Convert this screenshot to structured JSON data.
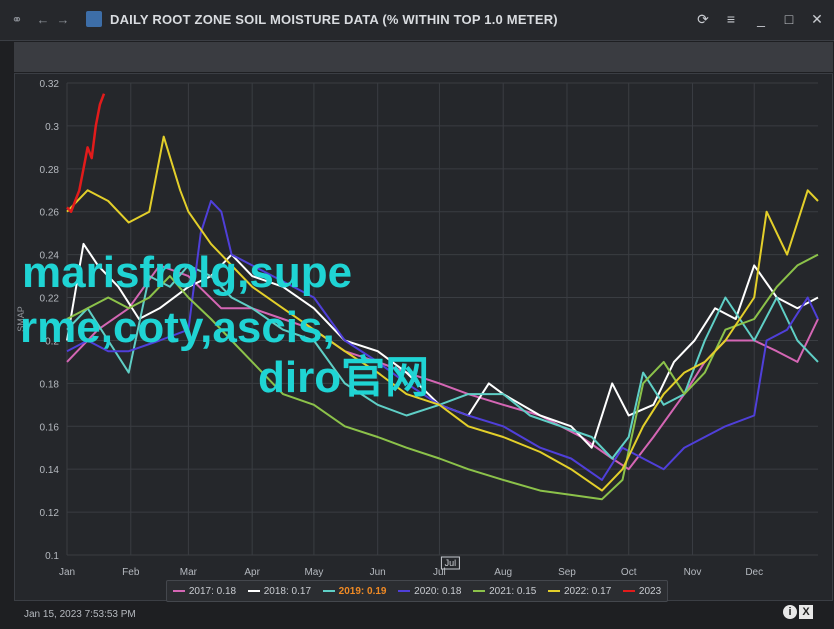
{
  "window": {
    "title": "DAILY ROOT ZONE SOIL MOISTURE DATA (% WITHIN TOP 1.0 METER)",
    "nav_back": "←",
    "nav_forward": "→",
    "refresh": "⟳",
    "menu": "≡",
    "minimize": "_",
    "maximize": "□",
    "close": "✕"
  },
  "footer": {
    "timestamp": "Jan 15, 2023 7:53:53 PM",
    "info": "i",
    "close_x": "X"
  },
  "watermark": {
    "line1": "marisfrolg,supe",
    "line2": "rme,coty,ascis,",
    "line3": "diro官网"
  },
  "chart_data": {
    "type": "line",
    "ylabel": "SMAP",
    "ylim": [
      0.1,
      0.32
    ],
    "yticks": [
      "0.32",
      "0.3",
      "0.28",
      "0.26",
      "0.24",
      "0.22",
      "0.2",
      "0.18",
      "0.16",
      "0.14",
      "0.12",
      "0.1"
    ],
    "xlim": [
      0,
      365
    ],
    "months": [
      {
        "label": "Jan",
        "day": 0
      },
      {
        "label": "Feb",
        "day": 31
      },
      {
        "label": "Mar",
        "day": 59
      },
      {
        "label": "Apr",
        "day": 90
      },
      {
        "label": "May",
        "day": 120
      },
      {
        "label": "Jun",
        "day": 151
      },
      {
        "label": "Jul",
        "day": 181
      },
      {
        "label": "Aug",
        "day": 212
      },
      {
        "label": "Sep",
        "day": 243
      },
      {
        "label": "Oct",
        "day": 273
      },
      {
        "label": "Nov",
        "day": 304
      },
      {
        "label": "Dec",
        "day": 334
      }
    ],
    "marker_label": "Jul",
    "grid": true,
    "legend_position": "bottom",
    "series": [
      {
        "name": "2017",
        "legend": "2017: 0.18",
        "color": "#d466b4",
        "points": [
          [
            0,
            0.19
          ],
          [
            15,
            0.205
          ],
          [
            30,
            0.215
          ],
          [
            45,
            0.235
          ],
          [
            59,
            0.23
          ],
          [
            75,
            0.215
          ],
          [
            90,
            0.215
          ],
          [
            105,
            0.21
          ],
          [
            120,
            0.205
          ],
          [
            135,
            0.195
          ],
          [
            151,
            0.19
          ],
          [
            165,
            0.185
          ],
          [
            181,
            0.18
          ],
          [
            195,
            0.175
          ],
          [
            212,
            0.17
          ],
          [
            230,
            0.165
          ],
          [
            250,
            0.155
          ],
          [
            265,
            0.145
          ],
          [
            273,
            0.14
          ],
          [
            285,
            0.155
          ],
          [
            300,
            0.175
          ],
          [
            310,
            0.19
          ],
          [
            320,
            0.2
          ],
          [
            334,
            0.2
          ],
          [
            345,
            0.195
          ],
          [
            355,
            0.19
          ],
          [
            365,
            0.21
          ]
        ]
      },
      {
        "name": "2018",
        "legend": "2018: 0.17",
        "color": "#ffffff",
        "points": [
          [
            0,
            0.2
          ],
          [
            8,
            0.245
          ],
          [
            15,
            0.235
          ],
          [
            25,
            0.225
          ],
          [
            35,
            0.21
          ],
          [
            45,
            0.215
          ],
          [
            59,
            0.225
          ],
          [
            70,
            0.23
          ],
          [
            80,
            0.24
          ],
          [
            90,
            0.23
          ],
          [
            105,
            0.225
          ],
          [
            120,
            0.215
          ],
          [
            135,
            0.2
          ],
          [
            151,
            0.195
          ],
          [
            165,
            0.185
          ],
          [
            181,
            0.17
          ],
          [
            195,
            0.165
          ],
          [
            205,
            0.18
          ],
          [
            212,
            0.175
          ],
          [
            230,
            0.165
          ],
          [
            245,
            0.16
          ],
          [
            255,
            0.15
          ],
          [
            265,
            0.18
          ],
          [
            273,
            0.165
          ],
          [
            285,
            0.17
          ],
          [
            295,
            0.19
          ],
          [
            305,
            0.2
          ],
          [
            315,
            0.215
          ],
          [
            325,
            0.21
          ],
          [
            334,
            0.235
          ],
          [
            345,
            0.22
          ],
          [
            355,
            0.215
          ],
          [
            365,
            0.22
          ]
        ]
      },
      {
        "name": "2019",
        "legend": "2019: 0.19",
        "color": "#5fcfc6",
        "points": [
          [
            0,
            0.205
          ],
          [
            10,
            0.215
          ],
          [
            20,
            0.2
          ],
          [
            30,
            0.185
          ],
          [
            40,
            0.23
          ],
          [
            50,
            0.225
          ],
          [
            59,
            0.235
          ],
          [
            70,
            0.23
          ],
          [
            80,
            0.22
          ],
          [
            90,
            0.215
          ],
          [
            105,
            0.205
          ],
          [
            120,
            0.2
          ],
          [
            135,
            0.18
          ],
          [
            151,
            0.17
          ],
          [
            165,
            0.165
          ],
          [
            181,
            0.17
          ],
          [
            195,
            0.175
          ],
          [
            212,
            0.175
          ],
          [
            225,
            0.165
          ],
          [
            240,
            0.16
          ],
          [
            255,
            0.155
          ],
          [
            265,
            0.145
          ],
          [
            273,
            0.155
          ],
          [
            280,
            0.185
          ],
          [
            290,
            0.17
          ],
          [
            300,
            0.175
          ],
          [
            310,
            0.2
          ],
          [
            320,
            0.22
          ],
          [
            334,
            0.2
          ],
          [
            345,
            0.22
          ],
          [
            355,
            0.2
          ],
          [
            365,
            0.19
          ]
        ]
      },
      {
        "name": "2020",
        "legend": "2020: 0.18",
        "color": "#4f3fd9",
        "points": [
          [
            0,
            0.195
          ],
          [
            10,
            0.2
          ],
          [
            20,
            0.195
          ],
          [
            30,
            0.195
          ],
          [
            45,
            0.2
          ],
          [
            59,
            0.205
          ],
          [
            65,
            0.25
          ],
          [
            70,
            0.265
          ],
          [
            75,
            0.26
          ],
          [
            80,
            0.24
          ],
          [
            90,
            0.235
          ],
          [
            100,
            0.23
          ],
          [
            110,
            0.225
          ],
          [
            120,
            0.22
          ],
          [
            135,
            0.2
          ],
          [
            151,
            0.19
          ],
          [
            165,
            0.18
          ],
          [
            181,
            0.17
          ],
          [
            195,
            0.165
          ],
          [
            212,
            0.16
          ],
          [
            230,
            0.15
          ],
          [
            245,
            0.145
          ],
          [
            260,
            0.135
          ],
          [
            270,
            0.15
          ],
          [
            280,
            0.145
          ],
          [
            290,
            0.14
          ],
          [
            300,
            0.15
          ],
          [
            310,
            0.155
          ],
          [
            320,
            0.16
          ],
          [
            334,
            0.165
          ],
          [
            340,
            0.2
          ],
          [
            350,
            0.205
          ],
          [
            360,
            0.22
          ],
          [
            365,
            0.21
          ]
        ]
      },
      {
        "name": "2021",
        "legend": "2021: 0.15",
        "color": "#8cc24a",
        "points": [
          [
            0,
            0.21
          ],
          [
            10,
            0.215
          ],
          [
            20,
            0.22
          ],
          [
            30,
            0.215
          ],
          [
            40,
            0.22
          ],
          [
            50,
            0.23
          ],
          [
            59,
            0.22
          ],
          [
            70,
            0.21
          ],
          [
            80,
            0.2
          ],
          [
            90,
            0.19
          ],
          [
            105,
            0.175
          ],
          [
            120,
            0.17
          ],
          [
            135,
            0.16
          ],
          [
            151,
            0.155
          ],
          [
            165,
            0.15
          ],
          [
            181,
            0.145
          ],
          [
            195,
            0.14
          ],
          [
            212,
            0.135
          ],
          [
            230,
            0.13
          ],
          [
            245,
            0.128
          ],
          [
            260,
            0.126
          ],
          [
            270,
            0.135
          ],
          [
            280,
            0.18
          ],
          [
            290,
            0.19
          ],
          [
            300,
            0.175
          ],
          [
            310,
            0.185
          ],
          [
            320,
            0.205
          ],
          [
            334,
            0.21
          ],
          [
            345,
            0.225
          ],
          [
            355,
            0.235
          ],
          [
            365,
            0.24
          ]
        ]
      },
      {
        "name": "2022",
        "legend": "2022: 0.17",
        "color": "#e3cf2a",
        "points": [
          [
            0,
            0.26
          ],
          [
            10,
            0.27
          ],
          [
            20,
            0.265
          ],
          [
            30,
            0.255
          ],
          [
            40,
            0.26
          ],
          [
            47,
            0.295
          ],
          [
            55,
            0.27
          ],
          [
            59,
            0.26
          ],
          [
            70,
            0.245
          ],
          [
            80,
            0.235
          ],
          [
            90,
            0.225
          ],
          [
            105,
            0.215
          ],
          [
            120,
            0.205
          ],
          [
            135,
            0.195
          ],
          [
            151,
            0.185
          ],
          [
            165,
            0.175
          ],
          [
            181,
            0.17
          ],
          [
            195,
            0.16
          ],
          [
            212,
            0.155
          ],
          [
            230,
            0.148
          ],
          [
            245,
            0.14
          ],
          [
            260,
            0.13
          ],
          [
            270,
            0.14
          ],
          [
            280,
            0.16
          ],
          [
            290,
            0.175
          ],
          [
            300,
            0.185
          ],
          [
            310,
            0.19
          ],
          [
            320,
            0.2
          ],
          [
            334,
            0.22
          ],
          [
            340,
            0.26
          ],
          [
            350,
            0.24
          ],
          [
            360,
            0.27
          ],
          [
            365,
            0.265
          ]
        ]
      },
      {
        "name": "2023",
        "legend": "2023",
        "color": "#e21b1b",
        "points": [
          [
            0,
            0.262
          ],
          [
            2,
            0.26
          ],
          [
            4,
            0.265
          ],
          [
            6,
            0.27
          ],
          [
            8,
            0.28
          ],
          [
            10,
            0.29
          ],
          [
            12,
            0.285
          ],
          [
            14,
            0.3
          ],
          [
            16,
            0.31
          ],
          [
            18,
            0.315
          ]
        ]
      }
    ]
  }
}
